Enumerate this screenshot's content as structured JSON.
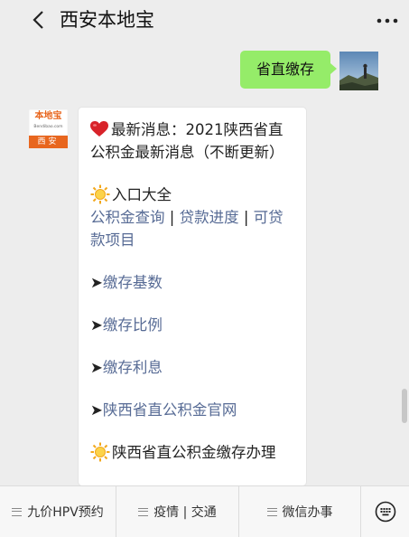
{
  "header": {
    "title": "西安本地宝"
  },
  "user_message": {
    "text": "省直缴存"
  },
  "bot_avatar": {
    "logo_text": "本地宝",
    "site_text": "Bendibao.com",
    "city": "西安"
  },
  "bot_message": {
    "news_prefix": "最新消息：2021陕西省直公积金最新消息（不断更新）",
    "entry_heading": "入口大全",
    "entry_links": [
      "公积金查询",
      "贷款进度",
      "可贷款项目"
    ],
    "separator": "|",
    "arrow": "➤",
    "items": [
      "缴存基数",
      "缴存比例",
      "缴存利息",
      "陕西省直公积金官网"
    ],
    "truncated_heading": "陕西省直公积金缴存办理"
  },
  "bottom_menu": {
    "items": [
      "九价HPV预约",
      "疫情 | 交通",
      "微信办事"
    ]
  },
  "colors": {
    "user_bubble": "#95ec69",
    "link": "#576b95",
    "logo_orange": "#e8661e"
  }
}
